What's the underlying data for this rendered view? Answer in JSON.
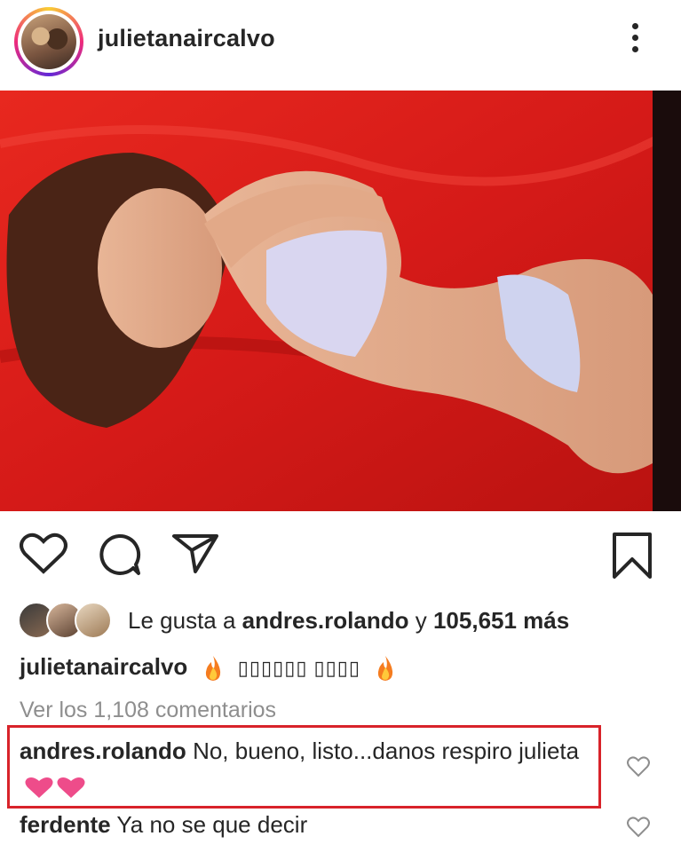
{
  "header": {
    "username": "julietanaircalvo"
  },
  "post": {
    "image_desc": "photo"
  },
  "likes": {
    "prefix": "Le gusta a",
    "user": "andres.rolando",
    "conj": "y",
    "count": "105,651 más"
  },
  "caption": {
    "user": "julietanaircalvo",
    "text": "▯▯▯▯▯▯ ▯▯▯▯"
  },
  "comments_link": "Ver los 1,108 comentarios",
  "comments": [
    {
      "user": "andres.rolando",
      "text": "No, bueno, listo...danos respiro julieta"
    },
    {
      "user": "ferdente",
      "text": "Ya no se que decir"
    }
  ],
  "colors": {
    "highlight": "#d8232a",
    "hearts": "#ee4c8a",
    "photo_bg": "#d91c1c"
  }
}
